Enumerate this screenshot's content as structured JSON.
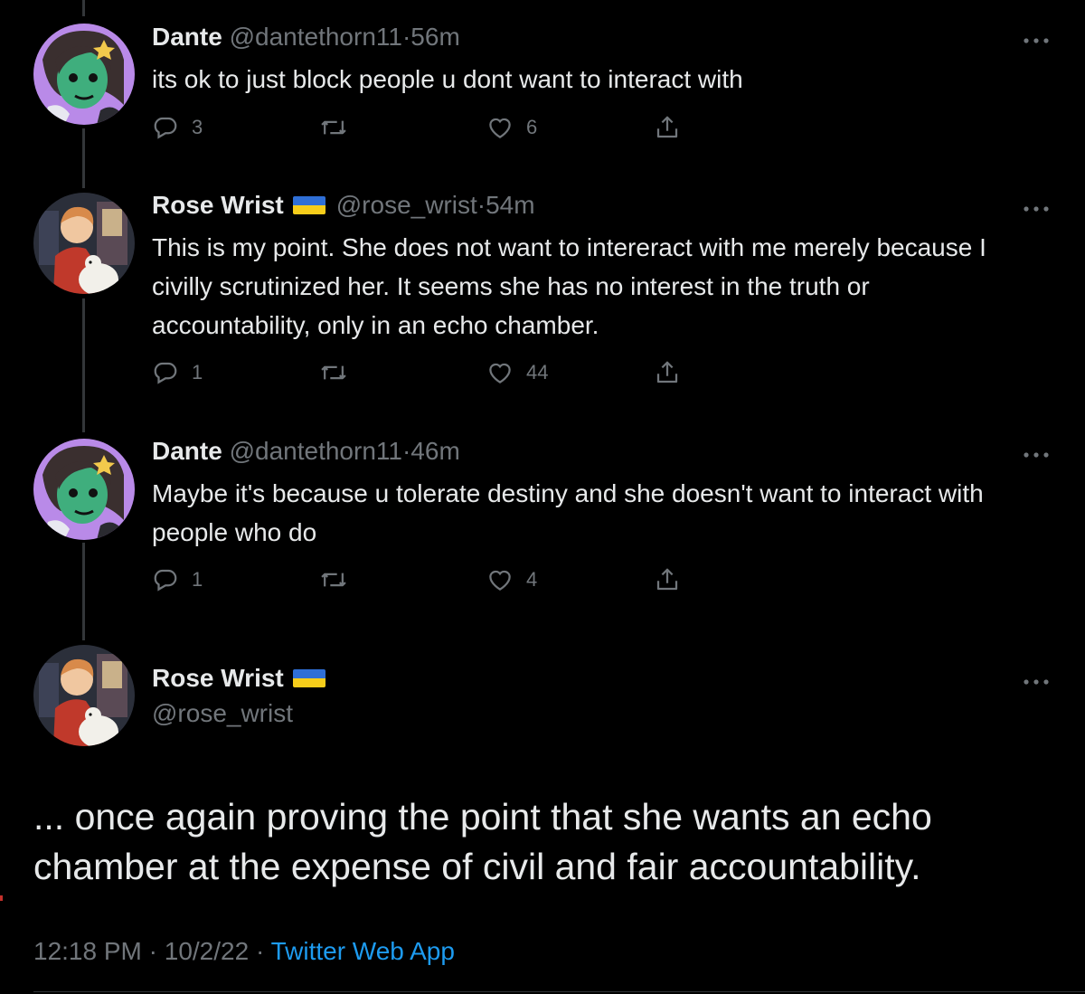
{
  "colors": {
    "background": "#000000",
    "text_primary": "#e7e9ea",
    "text_secondary": "#71767b",
    "link": "#1d9bf0",
    "thread_line": "#333639"
  },
  "replies": [
    {
      "name": "Dante",
      "handle": "@dantethorn11",
      "sep": "·",
      "time": "56m",
      "text": "its ok to just block people u dont want to interact with",
      "reply_count": "3",
      "retweet_count": "",
      "like_count": "6"
    },
    {
      "name": "Rose Wrist",
      "flag_icon": "ukraine-flag-icon",
      "handle": "@rose_wrist",
      "sep": "·",
      "time": "54m",
      "text": "This is my point. She does not want to intereract with me merely because I civilly scrutinized her. It seems she has no interest in the truth or accountability, only in an echo chamber.",
      "reply_count": "1",
      "retweet_count": "",
      "like_count": "44"
    },
    {
      "name": "Dante",
      "handle": "@dantethorn11",
      "sep": "·",
      "time": "46m",
      "text": "Maybe it's because u tolerate destiny and she doesn't want to interact with people who do",
      "reply_count": "1",
      "retweet_count": "",
      "like_count": "4"
    }
  ],
  "main_tweet": {
    "name": "Rose Wrist",
    "flag_icon": "ukraine-flag-icon",
    "handle": "@rose_wrist",
    "text": "... once again proving the point that she wants an echo chamber at the expense of civil and fair accountability.",
    "time": "12:18 PM",
    "sep1": "·",
    "date": "10/2/22",
    "sep2": "·",
    "source": "Twitter Web App"
  },
  "icons": [
    "reply-icon",
    "retweet-icon",
    "like-icon",
    "share-icon",
    "more-options-icon"
  ]
}
